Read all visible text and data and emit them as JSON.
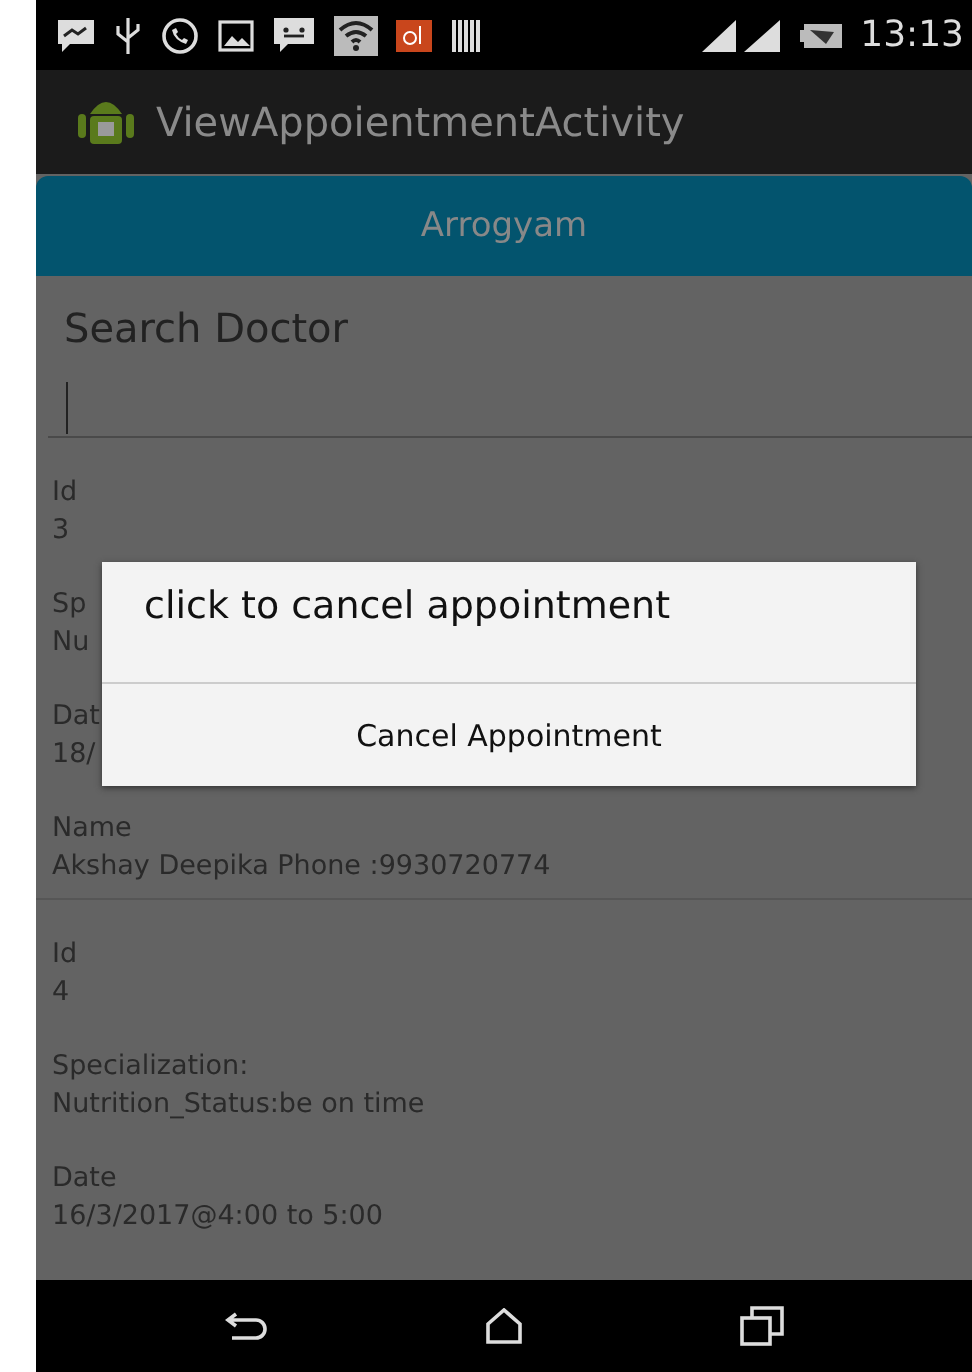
{
  "status_bar": {
    "time": "13:13"
  },
  "action_bar": {
    "title": "ViewAppoientmentActivity"
  },
  "header_button": {
    "label": "Arrogyam"
  },
  "search": {
    "title": "Search Doctor"
  },
  "appointments": [
    {
      "fields": [
        {
          "label": "Id",
          "value": "3"
        },
        {
          "label": "Sp",
          "value": "Nu"
        },
        {
          "label": "Dat",
          "value": "18/"
        },
        {
          "label": "Name",
          "value": "Akshay Deepika Phone :9930720774"
        }
      ]
    },
    {
      "fields": [
        {
          "label": "Id",
          "value": "4"
        },
        {
          "label": "Specialization:",
          "value": "Nutrition_Status:be on time"
        },
        {
          "label": "Date",
          "value": "16/3/2017@4:00 to 5:00"
        }
      ]
    }
  ],
  "dialog": {
    "message": "click to cancel appointment",
    "action": "Cancel Appointment"
  }
}
